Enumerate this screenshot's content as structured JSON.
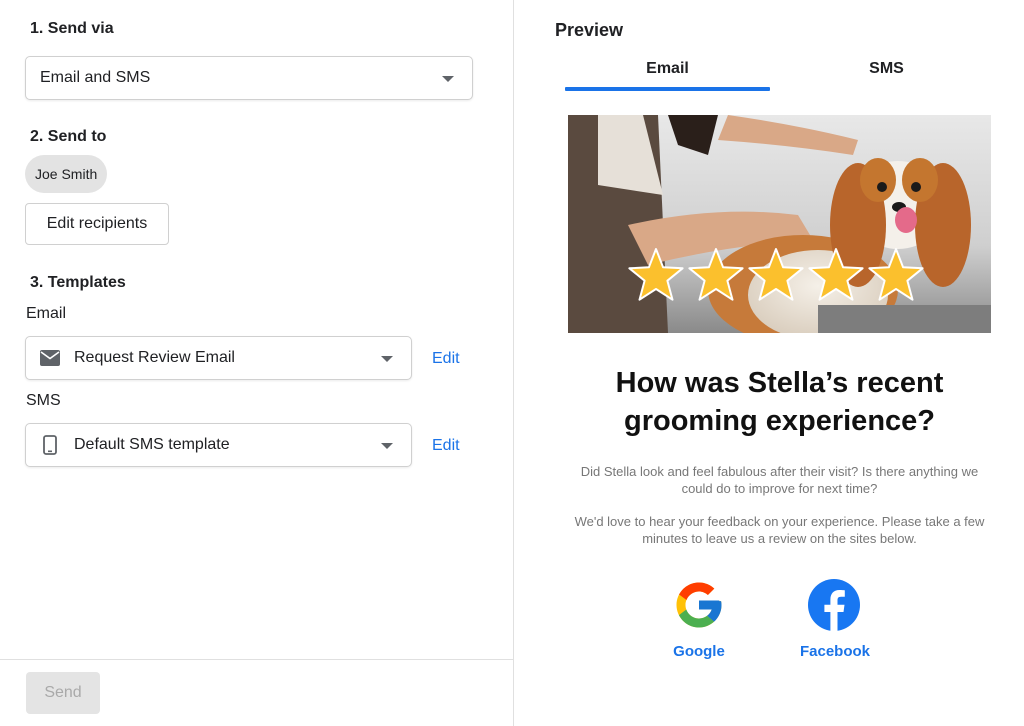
{
  "send_via": {
    "title": "1. Send via",
    "selected": "Email and SMS"
  },
  "send_to": {
    "title": "2. Send to",
    "recipient": "Joe Smith",
    "edit_button": "Edit recipients"
  },
  "templates": {
    "title": "3. Templates",
    "email": {
      "label": "Email",
      "selected": "Request Review Email",
      "icon": "mail-icon",
      "edit": "Edit"
    },
    "sms": {
      "label": "SMS",
      "selected": "Default SMS template",
      "icon": "phone-icon",
      "edit": "Edit"
    }
  },
  "footer": {
    "send_label": "Send"
  },
  "preview": {
    "title": "Preview",
    "tabs": [
      {
        "label": "Email",
        "active": true
      },
      {
        "label": "SMS",
        "active": false
      }
    ],
    "hero": {
      "stars": 5,
      "star_color": "#fbc02d"
    },
    "heading": "How was Stella’s recent grooming experience?",
    "paragraph1": "Did Stella look and feel fabulous after their visit? Is there anything we could do to improve for next time?",
    "paragraph2": "We'd love to hear your feedback on your experience. Please take a few minutes to leave us a review on the sites below.",
    "social": [
      {
        "name": "Google",
        "icon": "google-icon"
      },
      {
        "name": "Facebook",
        "icon": "facebook-icon",
        "color": "#1877f2"
      }
    ]
  },
  "colors": {
    "accent": "#1a73e8",
    "disabled_bg": "#e4e4e4"
  }
}
